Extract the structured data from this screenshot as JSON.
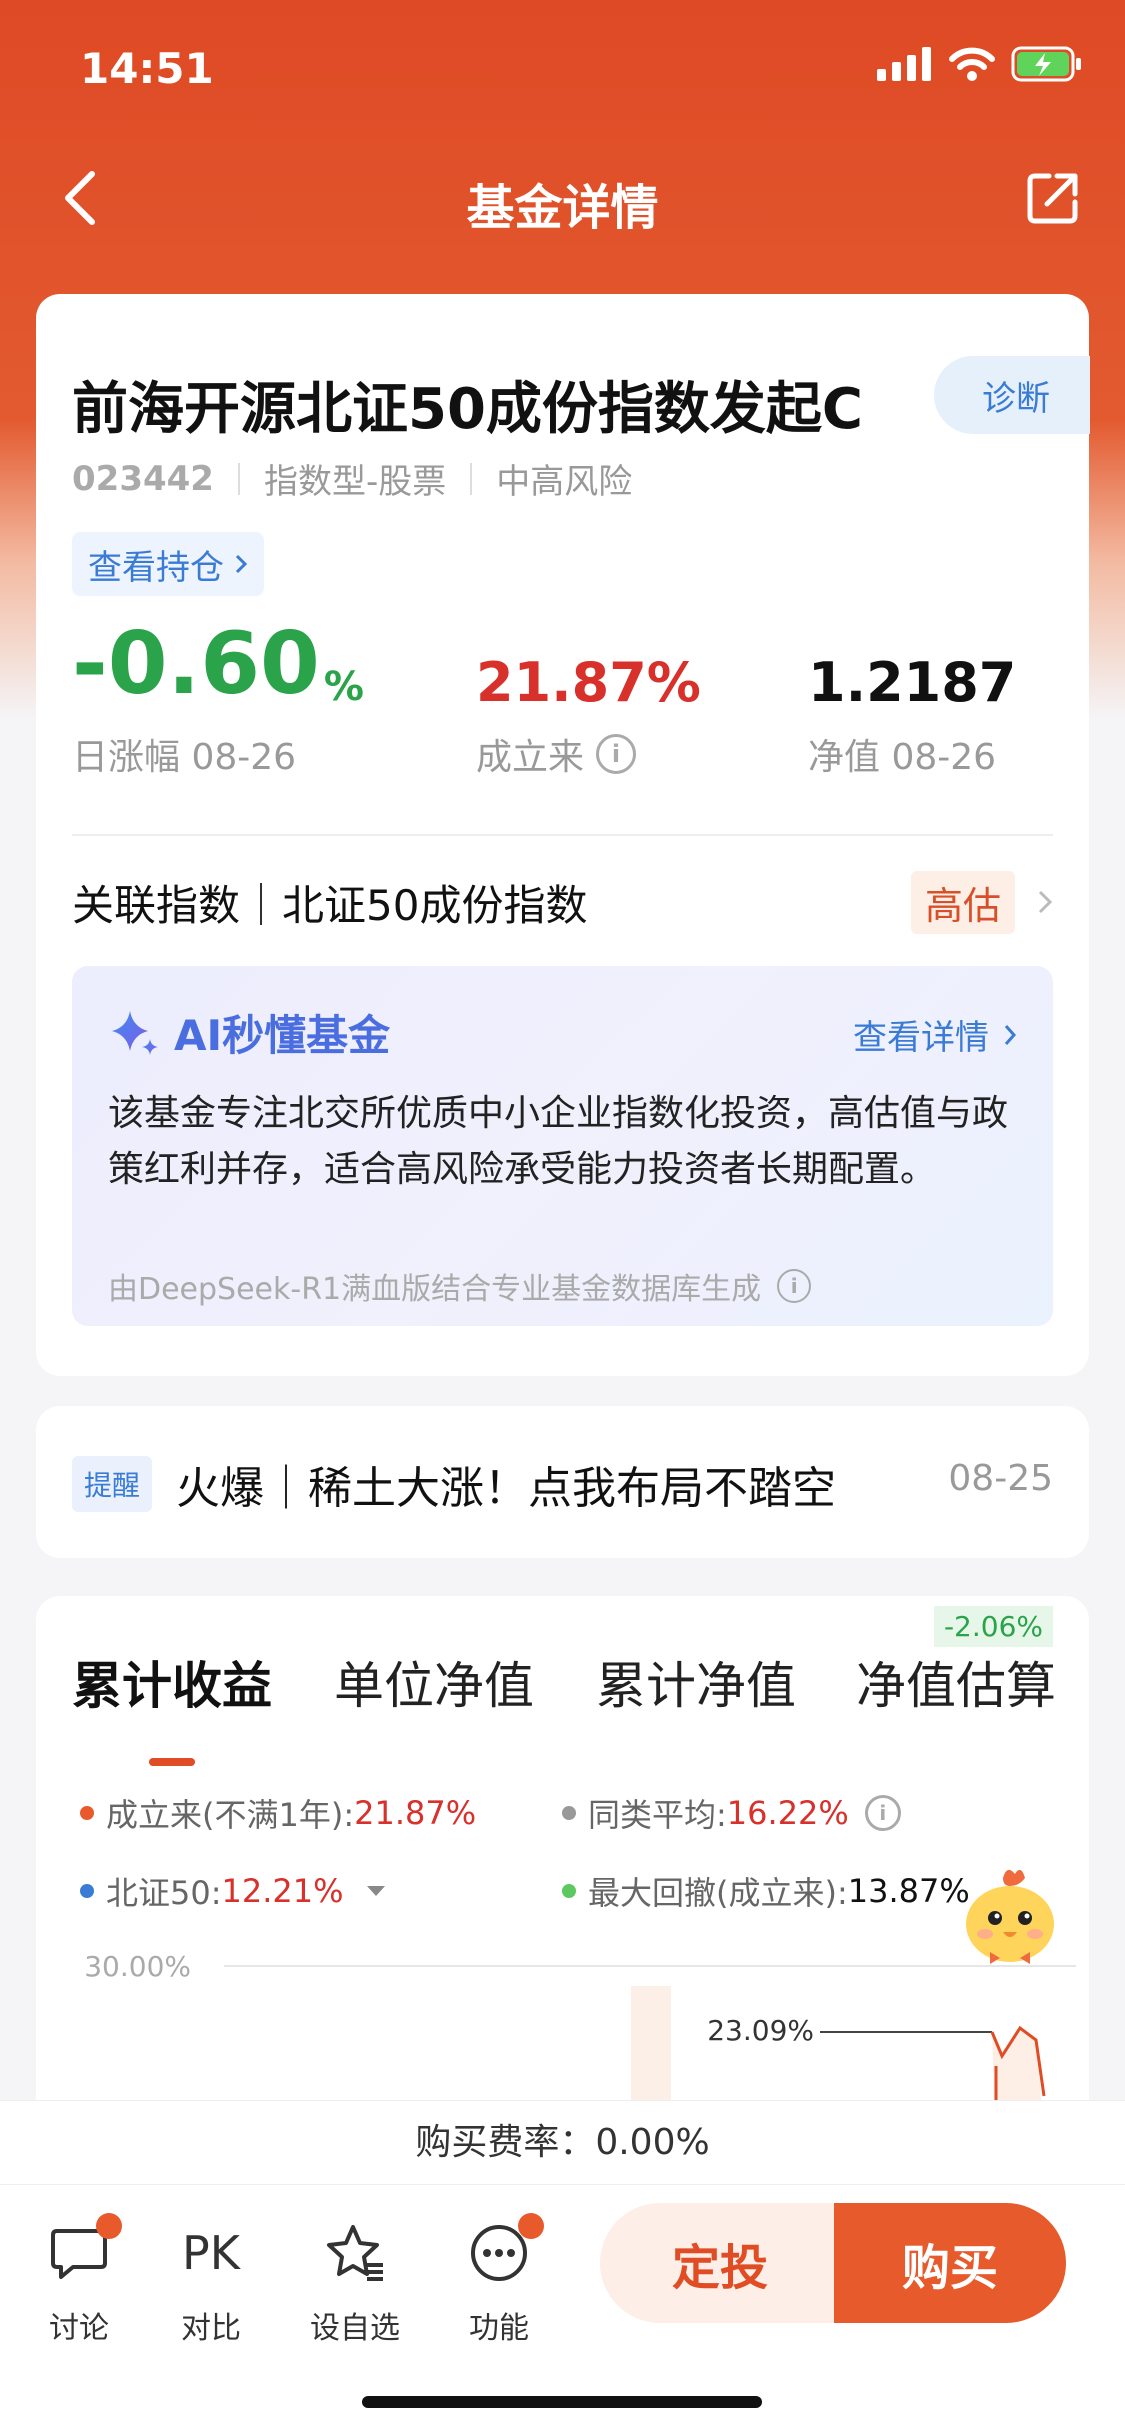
{
  "status": {
    "time": "14:51"
  },
  "nav": {
    "title": "基金详情"
  },
  "fund": {
    "name": "前海开源北证50成份指数发起C",
    "diagnose_label": "诊断",
    "code": "023442",
    "type": "指数型-股票",
    "risk": "中高风险",
    "holdings_label": "查看持仓"
  },
  "stats": {
    "daily_change": "-0.60",
    "daily_change_unit": "%",
    "daily_label": "日涨幅 08-26",
    "since_inception": "21.87%",
    "since_label": "成立来",
    "nav_value": "1.2187",
    "nav_label": "净值 08-26"
  },
  "index_row": {
    "text": "关联指数｜北证50成份指数",
    "valuation_tag": "高估"
  },
  "ai": {
    "title": "AI秒懂基金",
    "link": "查看详情",
    "text": "该基金专注北交所优质中小企业指数化投资，高估值与政策红利并存，适合高风险承受能力投资者长期配置。",
    "source": "由DeepSeek-R1满血版结合专业基金数据库生成"
  },
  "reminder": {
    "tag": "提醒",
    "text": "火爆｜稀土大涨！点我布局不踏空",
    "date": "08-25"
  },
  "tabs": {
    "items": [
      "累计收益",
      "单位净值",
      "累计净值",
      "净值估算"
    ],
    "active": 0,
    "estimate_badge": "-2.06%"
  },
  "legend": {
    "fund_label": "成立来(不满1年):",
    "fund_value": "21.87%",
    "avg_label": "同类平均:",
    "avg_value": "16.22%",
    "index_label": "北证50:",
    "index_value": "12.21%",
    "drawdown_label": "最大回撤(成立来):",
    "drawdown_value": "13.87%"
  },
  "chart_data": {
    "type": "line",
    "y_tick_labels": [
      "30.00%"
    ],
    "annotation": "23.09%",
    "series": [
      {
        "name": "成立来(不满1年)",
        "color": "#e04c24"
      }
    ]
  },
  "fee": {
    "text": "购买费率：0.00%"
  },
  "bottom_bar": {
    "discuss": "讨论",
    "compare_icon_text": "PK",
    "compare": "对比",
    "watchlist": "设自选",
    "functions": "功能",
    "auto_invest": "定投",
    "buy": "购买"
  },
  "colors": {
    "brand": "#e04c24",
    "up": "#d8302a",
    "down": "#2aa34a",
    "link": "#3a7bd5"
  }
}
